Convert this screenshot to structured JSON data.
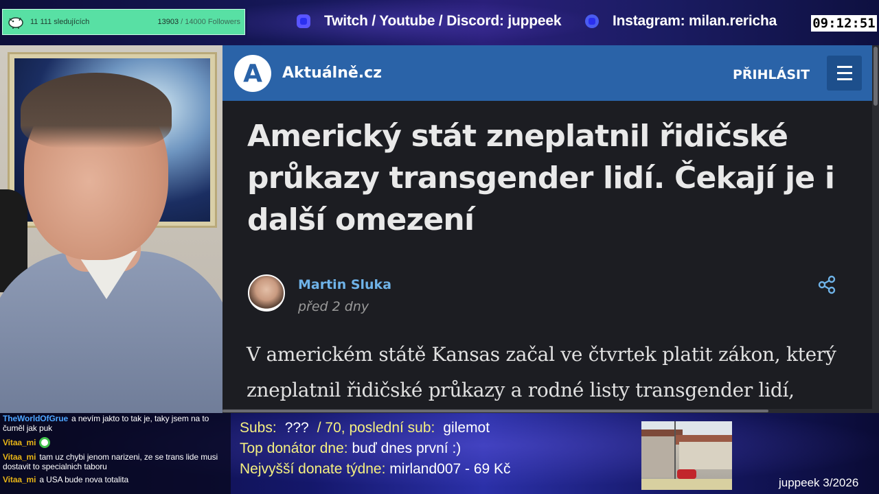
{
  "overlay": {
    "follower_goal": {
      "label": "11 111 sledujících",
      "current": "13903",
      "rest": "/ 14000 Followers",
      "progress_fraction": 0.993
    },
    "socials": [
      {
        "icon": "twitch-icon",
        "text": "Twitch / Youtube / Discord: juppeek"
      },
      {
        "icon": "instagram-icon",
        "text": "Instagram: milan.rericha"
      }
    ],
    "clock": "09:12:51",
    "stats": {
      "subs_label": "Subs:",
      "subs_value": "???",
      "subs_goal_text": "/ 70, poslední sub:",
      "last_sub": "gilemot",
      "top_donor_label": "Top donátor dne:",
      "top_donor_value": "buď dnes první :)",
      "weekly_top_label": "Nejvyšší donate týdne:",
      "weekly_top_value": "mirland007 - 69 Kč"
    },
    "stamp": "juppeek 3/2026"
  },
  "chat": [
    {
      "user": "TheWorldOfGrue",
      "color": "#4ea6ff",
      "text": "a nevím jakto to tak je, taky jsem na to čuměl jak puk"
    },
    {
      "user": "Vitaa_mi",
      "color": "#e7b416",
      "text": "",
      "emote": "green-blob-emote"
    },
    {
      "user": "Vitaa_mi",
      "color": "#e7b416",
      "text": "tam uz chybi jenom narizeni, ze se trans lide musi dostavit to specialnich taboru"
    },
    {
      "user": "Vitaa_mi",
      "color": "#e7b416",
      "text": "a USA bude nova totalita"
    }
  ],
  "site": {
    "logo_letter": "A",
    "brand": "Aktuálně.cz",
    "login": "PŘIHLÁSIT",
    "headline": "Americký stát zneplatnil řidičské průkazy transgender lidí. Čekají je i další omezení",
    "author": "Martin Sluka",
    "date": "před 2 dny",
    "body": "V americkém státě Kansas začal ve čtvrtek platit zákon, který zneplatnil řidičské průkazy a rodné listy transgender lidí,",
    "colors": {
      "header": "#2a63a8",
      "link": "#6fb3e8",
      "background": "#1c1d22"
    }
  }
}
